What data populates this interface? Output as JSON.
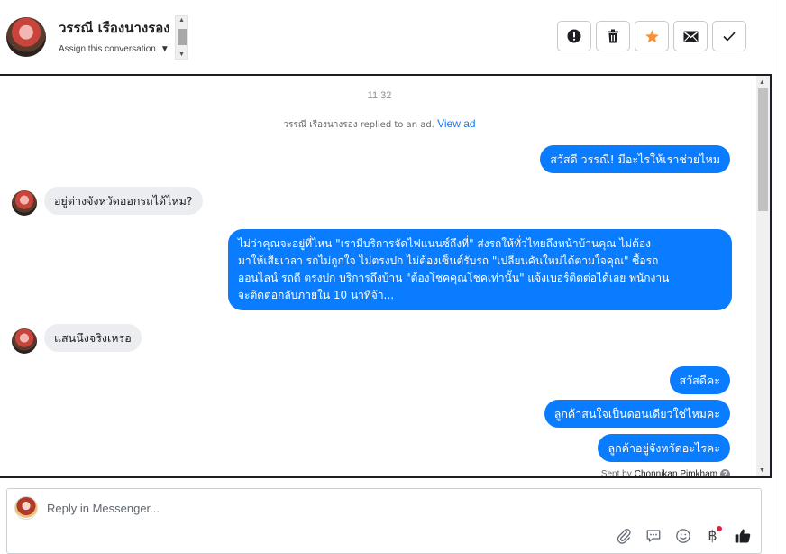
{
  "header": {
    "contact_name": "วรรณี เรืองนางรอง",
    "assign_label": "Assign this conversation",
    "actions": [
      {
        "name": "mark-spam-button",
        "icon": "exclamation-circle-icon"
      },
      {
        "name": "delete-button",
        "icon": "trash-icon"
      },
      {
        "name": "star-button",
        "icon": "star-icon",
        "color": "#f5923e"
      },
      {
        "name": "mark-unread-button",
        "icon": "envelope-icon"
      },
      {
        "name": "mark-done-button",
        "icon": "check-icon"
      }
    ]
  },
  "conversation": {
    "timestamp": "11:32",
    "ad_note": "วรรณี เรืองนางรอง replied to an ad.",
    "ad_link": "View ad",
    "messages": [
      {
        "from": "page",
        "text": "สวัสดี วรรณี! มีอะไรให้เราช่วยไหม"
      },
      {
        "from": "customer",
        "text": "อยู่ต่างจังหวัดออกรถได้ไหม?"
      },
      {
        "from": "page",
        "lines": [
          "ไม่ว่าคุณจะอยู่ที่ไหน \"เรามีบริการจัดไฟแนนซ์ถึงที่\"  ส่งรถให้ทั่วไทยถึงหน้าบ้านคุณ ไม่ต้อง",
          "มาให้เสียเวลา รถไม่ถูกใจ ไม่ตรงปก ไม่ต้องเซ็นต์รับรถ \"เปลี่ยนคันใหม่ได้ตามใจคุณ\" ซื้อรถ",
          "ออนไลน์ รถดี ตรงปก บริการถึงบ้าน \"ต้องโชคคุณโชคเท่านั้น\" แจ้งเบอร์ติดต่อได้เลย พนักงาน",
          "จะติดต่อกลับภายใน 10 นาทีจ้า..."
        ]
      },
      {
        "from": "customer",
        "text": "แสนนึงจริงเหรอ"
      },
      {
        "from": "page",
        "text": "สวัสดีคะ"
      },
      {
        "from": "page",
        "text": "ลูกค้าสนใจเป็นดอนเดียวใช่ไหมคะ"
      },
      {
        "from": "page",
        "text": "ลูกค้าอยู่จังหวัดอะไรคะ"
      }
    ],
    "sent_by_prefix": "Sent by",
    "sent_by_name": "Chonnikan Pimkham",
    "help_glyph": "?"
  },
  "composer": {
    "placeholder": "Reply in Messenger...",
    "tools": [
      "paperclip-icon",
      "saved-reply-icon",
      "emoji-icon",
      "baht-icon",
      "thumbs-up-icon"
    ],
    "baht_glyph": "฿"
  },
  "colors": {
    "outgoing_bubble": "#0a7cff",
    "incoming_bubble": "#ebedf0",
    "link": "#1877f2",
    "star": "#f5923e"
  }
}
